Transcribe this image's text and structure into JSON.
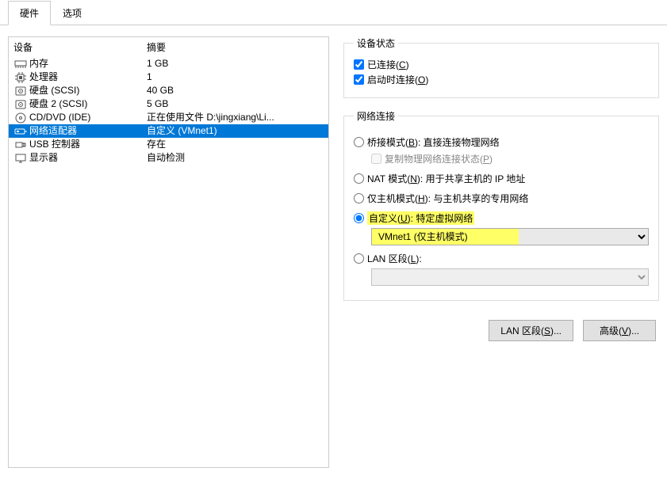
{
  "tabs": {
    "hardware": "硬件",
    "options": "选项"
  },
  "list": {
    "header_device": "设备",
    "header_summary": "摘要",
    "items": [
      {
        "label": "内存",
        "summary": "1 GB",
        "icon": "memory"
      },
      {
        "label": "处理器",
        "summary": "1",
        "icon": "cpu"
      },
      {
        "label": "硬盘 (SCSI)",
        "summary": "40 GB",
        "icon": "disk"
      },
      {
        "label": "硬盘 2 (SCSI)",
        "summary": "5 GB",
        "icon": "disk"
      },
      {
        "label": "CD/DVD (IDE)",
        "summary": "正在使用文件 D:\\jingxiang\\Li...",
        "icon": "cd"
      },
      {
        "label": "网络适配器",
        "summary": "自定义 (VMnet1)",
        "icon": "net",
        "selected": true
      },
      {
        "label": "USB 控制器",
        "summary": "存在",
        "icon": "usb"
      },
      {
        "label": "显示器",
        "summary": "自动检测",
        "icon": "display"
      }
    ]
  },
  "device_state": {
    "legend": "设备状态",
    "connected_label": "已连接(",
    "connected_key": "C",
    "connected_suffix": ")",
    "connect_at_power_label": "启动时连接(",
    "connect_at_power_key": "O",
    "connect_at_power_suffix": ")"
  },
  "net": {
    "legend": "网络连接",
    "bridged_pre": "桥接模式(",
    "bridged_key": "B",
    "bridged_post": "): 直接连接物理网络",
    "replicate_pre": "复制物理网络连接状态(",
    "replicate_key": "P",
    "replicate_post": ")",
    "nat_pre": "NAT 模式(",
    "nat_key": "N",
    "nat_post": "): 用于共享主机的 IP 地址",
    "hostonly_pre": "仅主机模式(",
    "hostonly_key": "H",
    "hostonly_post": "): 与主机共享的专用网络",
    "custom_pre": "自定义(",
    "custom_key": "U",
    "custom_post": "): 特定虚拟网络",
    "custom_option": "VMnet1 (仅主机模式)",
    "lan_pre": "LAN 区段(",
    "lan_key": "L",
    "lan_post": "):",
    "lan_option": ""
  },
  "buttons": {
    "lan_segments_pre": "LAN 区段(",
    "lan_segments_key": "S",
    "lan_segments_post": ")...",
    "advanced_pre": "高级(",
    "advanced_key": "V",
    "advanced_post": ")..."
  }
}
